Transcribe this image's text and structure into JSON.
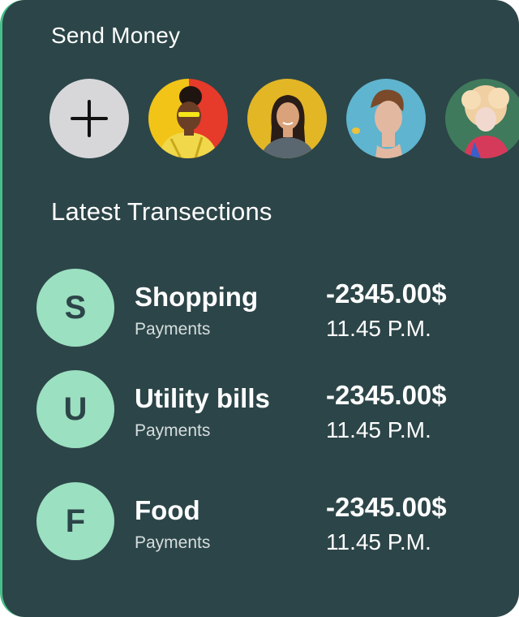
{
  "send_money": {
    "title": "Send Money",
    "add_icon": "plus-icon",
    "contacts": [
      {
        "avatar": "woman-with-sunglasses-avatar"
      },
      {
        "avatar": "smiling-woman-avatar"
      },
      {
        "avatar": "young-man-avatar"
      },
      {
        "avatar": "curly-haired-child-avatar"
      }
    ]
  },
  "transactions": {
    "title": "Latest Transections",
    "items": [
      {
        "initial": "S",
        "name": "Shopping",
        "type": "Payments",
        "amount": "-2345.00$",
        "time": "11.45 P.M."
      },
      {
        "initial": "U",
        "name": "Utility bills",
        "type": "Payments",
        "amount": "-2345.00$",
        "time": "11.45 P.M."
      },
      {
        "initial": "F",
        "name": "Food",
        "type": "Payments",
        "amount": "-2345.00$",
        "time": "11.45 P.M."
      }
    ]
  },
  "colors": {
    "card_background": "#2c4548",
    "accent_green": "#9be0c1",
    "add_button": "#d7d7d9"
  }
}
